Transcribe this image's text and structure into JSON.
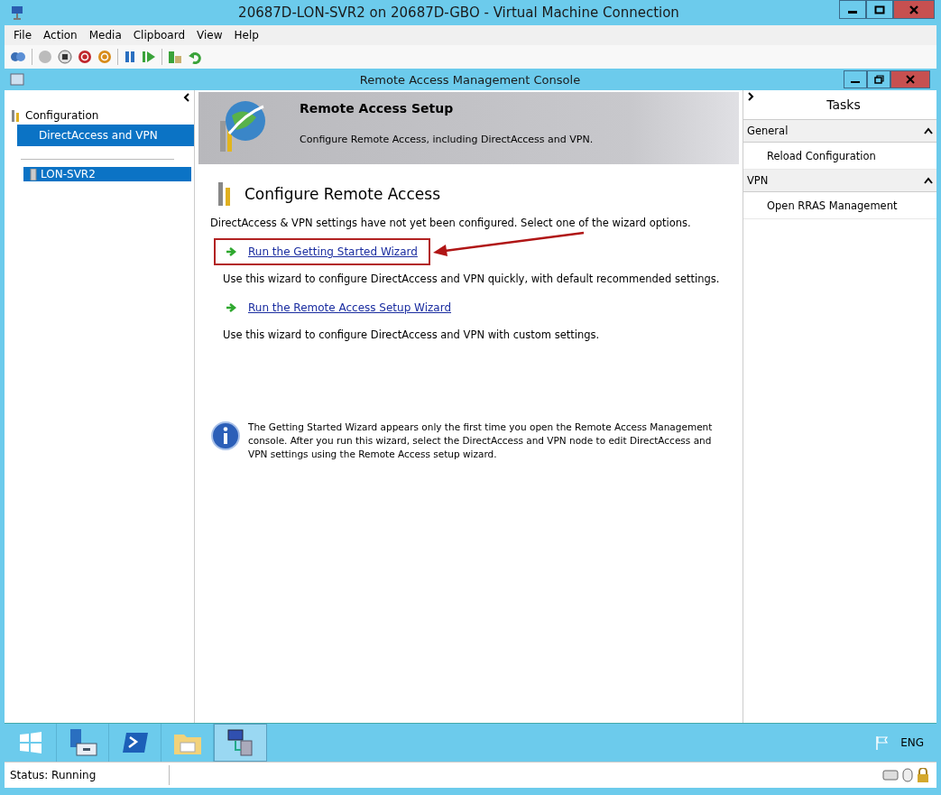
{
  "window": {
    "title": "20687D-LON-SVR2 on 20687D-GBO - Virtual Machine Connection"
  },
  "menu": [
    "File",
    "Action",
    "Media",
    "Clipboard",
    "View",
    "Help"
  ],
  "console": {
    "title": "Remote Access Management Console"
  },
  "tree": [
    {
      "label": "Configuration",
      "selected": false,
      "children": [
        {
          "label": "DirectAccess and VPN",
          "selected": true
        }
      ]
    },
    {
      "label": "LON-SVR2",
      "selected": true
    }
  ],
  "banner": {
    "title": "Remote Access Setup",
    "subtitle": "Configure Remote Access, including DirectAccess and VPN."
  },
  "content": {
    "heading": "Configure Remote Access",
    "intro": "DirectAccess & VPN settings have not yet been configured. Select one of the wizard options.",
    "wizards": [
      {
        "link": "Run the Getting Started Wizard",
        "description": "Use this wizard to configure DirectAccess and VPN quickly, with default recommended settings.",
        "highlighted": true
      },
      {
        "link": "Run the Remote Access Setup Wizard",
        "description": "Use this wizard to configure DirectAccess and VPN with custom settings.",
        "highlighted": false
      }
    ],
    "info": "The Getting Started Wizard appears only the first time you open the Remote Access Management console. After you run this wizard, select the DirectAccess and VPN node to edit DirectAccess and VPN settings using the Remote Access setup wizard."
  },
  "tasks": {
    "title": "Tasks",
    "sections": [
      {
        "name": "General",
        "expanded": true,
        "items": [
          "Reload Configuration"
        ]
      },
      {
        "name": "VPN",
        "expanded": true,
        "items": [
          "Open RRAS Management"
        ]
      }
    ]
  },
  "taskbar": {
    "apps": [
      {
        "kind": "start",
        "selected": false
      },
      {
        "kind": "server",
        "selected": false
      },
      {
        "kind": "shell",
        "selected": false
      },
      {
        "kind": "folder",
        "selected": false
      },
      {
        "kind": "network",
        "selected": true
      }
    ],
    "language": "ENG"
  },
  "status_bar": {
    "text": "Status: Running"
  }
}
